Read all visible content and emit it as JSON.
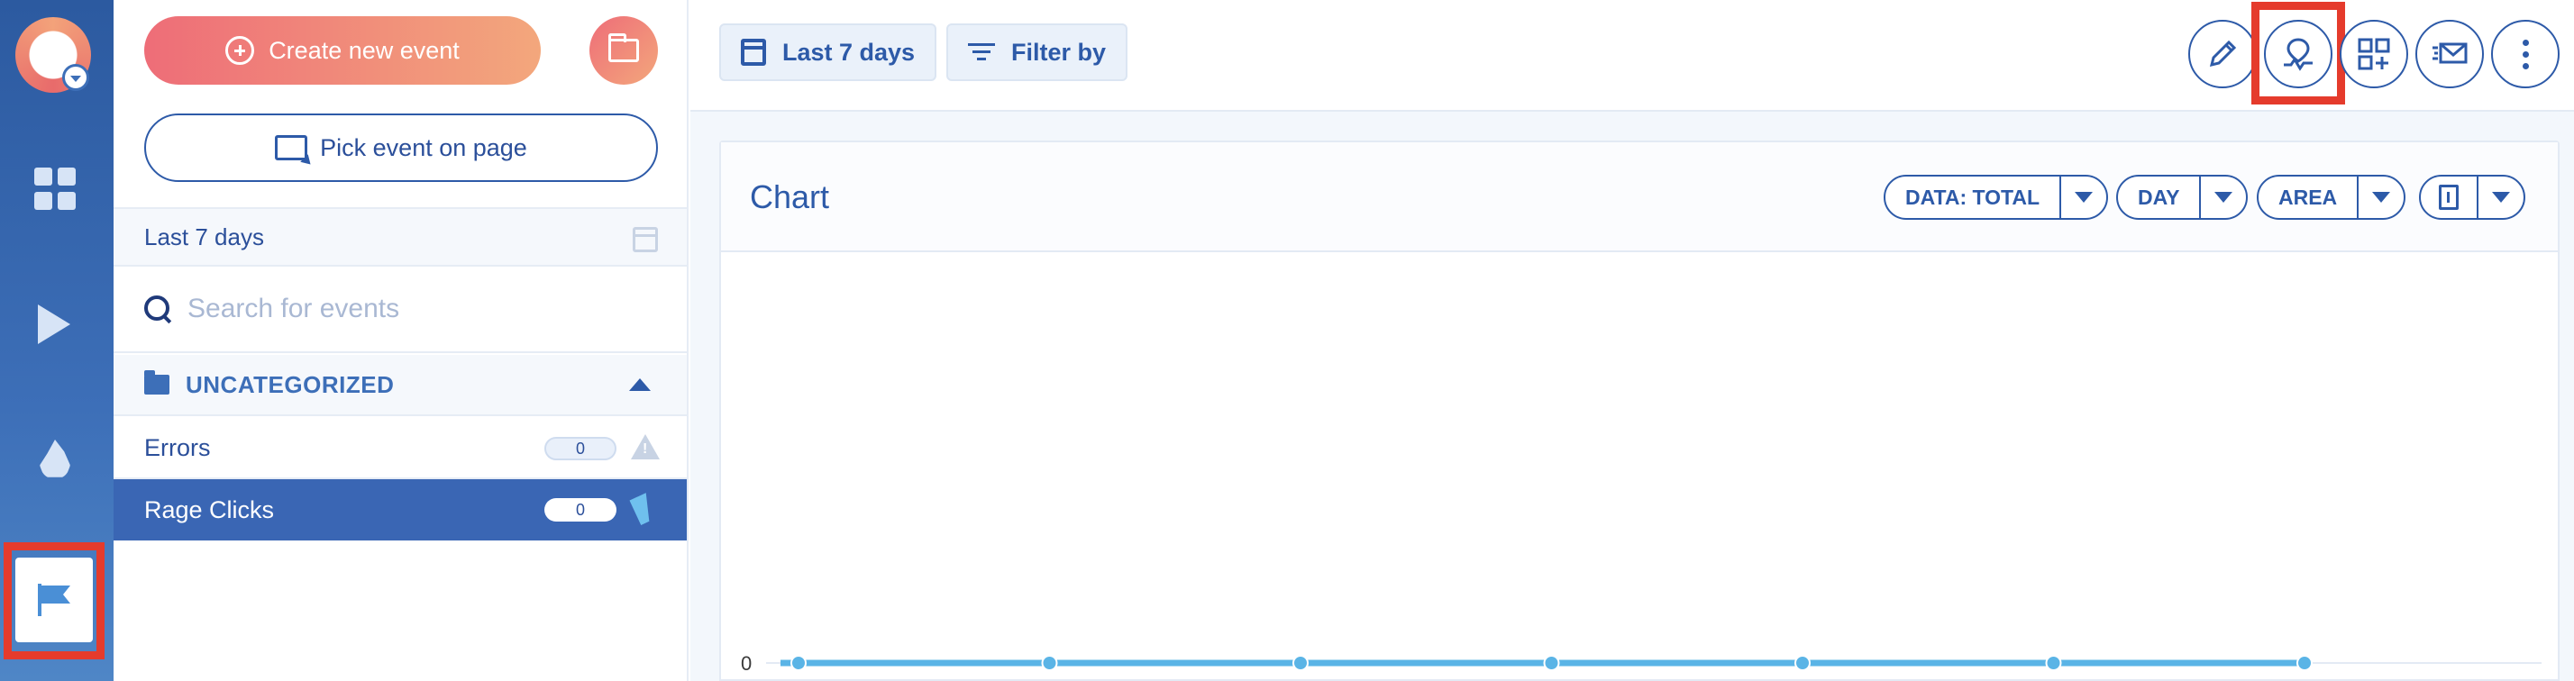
{
  "sidebar": {
    "nav_icons": [
      "dashboard-icon",
      "play-icon",
      "flame-icon",
      "flag-icon"
    ],
    "active_item": "flag-icon"
  },
  "events_panel": {
    "create_label": "Create new event",
    "pick_label": "Pick event on page",
    "date_range": "Last 7 days",
    "search": {
      "placeholder": "Search for events",
      "value": ""
    },
    "category": "UNCATEGORIZED",
    "events": [
      {
        "label": "Errors",
        "count": "0",
        "icon": "warning-icon",
        "selected": false
      },
      {
        "label": "Rage Clicks",
        "count": "0",
        "icon": "cursor-icon",
        "selected": true
      }
    ]
  },
  "toolbar": {
    "date_label": "Last 7 days",
    "filter_label": "Filter by",
    "actions": [
      "edit-icon",
      "heatmap-pin-icon",
      "add-to-dashboard-icon",
      "email-report-icon",
      "more-icon"
    ],
    "highlighted_action": "heatmap-pin-icon"
  },
  "chart": {
    "title": "Chart",
    "data_mode": "DATA: TOTAL",
    "interval": "DAY",
    "chart_type": "AREA",
    "export_icon": "export-file-icon"
  },
  "chart_data": {
    "type": "area",
    "title": "",
    "x": [
      1,
      2,
      3,
      4,
      5,
      6,
      7
    ],
    "series": [
      {
        "values": [
          0,
          0,
          0,
          0,
          0,
          0,
          0
        ]
      }
    ],
    "y_ticks": [
      "0"
    ],
    "grid": true,
    "color": "#5ab4e6"
  },
  "colors": {
    "accent": "#2d5aa8",
    "selected_row": "#3a66b4",
    "highlight": "#e53b2c",
    "gradient_start": "#ee6d78",
    "gradient_end": "#f3a77c"
  }
}
